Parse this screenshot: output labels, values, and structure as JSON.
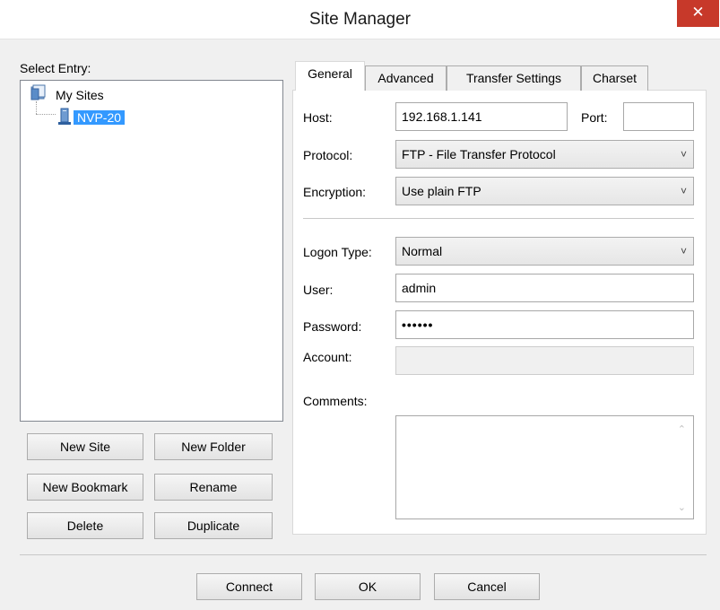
{
  "window": {
    "title": "Site Manager",
    "close_glyph": "✕"
  },
  "left": {
    "select_label": "Select Entry:",
    "tree": {
      "root_label": "My Sites",
      "child_label": "NVP-20"
    },
    "buttons": {
      "new_site": "New Site",
      "new_folder": "New Folder",
      "new_bookmark": "New Bookmark",
      "rename": "Rename",
      "delete": "Delete",
      "duplicate": "Duplicate"
    }
  },
  "tabs": [
    "General",
    "Advanced",
    "Transfer Settings",
    "Charset"
  ],
  "general": {
    "host_label": "Host:",
    "host_value": "192.168.1.141",
    "port_label": "Port:",
    "port_value": "",
    "protocol_label": "Protocol:",
    "protocol_value": "FTP - File Transfer Protocol",
    "encryption_label": "Encryption:",
    "encryption_value": "Use plain FTP",
    "logon_label": "Logon Type:",
    "logon_value": "Normal",
    "user_label": "User:",
    "user_value": "admin",
    "password_label": "Password:",
    "password_value": "••••••",
    "account_label": "Account:",
    "account_value": "",
    "comments_label": "Comments:"
  },
  "footer": {
    "connect": "Connect",
    "ok": "OK",
    "cancel": "Cancel"
  },
  "icons": {
    "chevron": "˅",
    "scroll_up": "⌃",
    "scroll_down": "⌄"
  },
  "colors": {
    "selection": "#3399ff",
    "close": "#c7392a"
  }
}
